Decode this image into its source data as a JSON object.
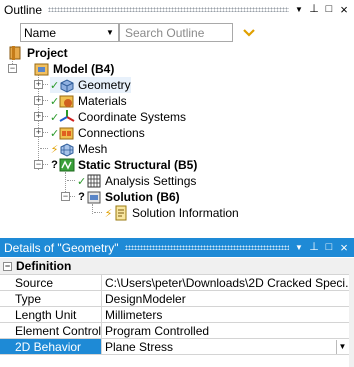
{
  "outline": {
    "title": "Outline",
    "name_filter": {
      "value": "Name"
    },
    "search": {
      "placeholder": "Search Outline"
    },
    "tree": {
      "project": "Project",
      "model": "Model (B4)",
      "geometry": "Geometry",
      "materials": "Materials",
      "coordinate_systems": "Coordinate Systems",
      "connections": "Connections",
      "mesh": "Mesh",
      "static_structural": "Static Structural (B5)",
      "analysis_settings": "Analysis Settings",
      "solution": "Solution (B6)",
      "solution_information": "Solution Information"
    }
  },
  "details": {
    "title": "Details of \"Geometry\"",
    "group": "Definition",
    "rows": [
      {
        "key": "Source",
        "value": "C:\\Users\\peter\\Downloads\\2D Cracked Speci..."
      },
      {
        "key": "Type",
        "value": "DesignModeler"
      },
      {
        "key": "Length Unit",
        "value": "Millimeters"
      },
      {
        "key": "Element Control",
        "value": "Program Controlled"
      },
      {
        "key": "2D Behavior",
        "value": "Plane Stress"
      }
    ]
  },
  "pane_buttons": {
    "dropdown": "▼",
    "pin": "⊥",
    "maximize": "□",
    "close": "×"
  },
  "colors": {
    "accent": "#1e8ad6",
    "check": "#2a9a2a",
    "bolt": "#e0a000"
  }
}
